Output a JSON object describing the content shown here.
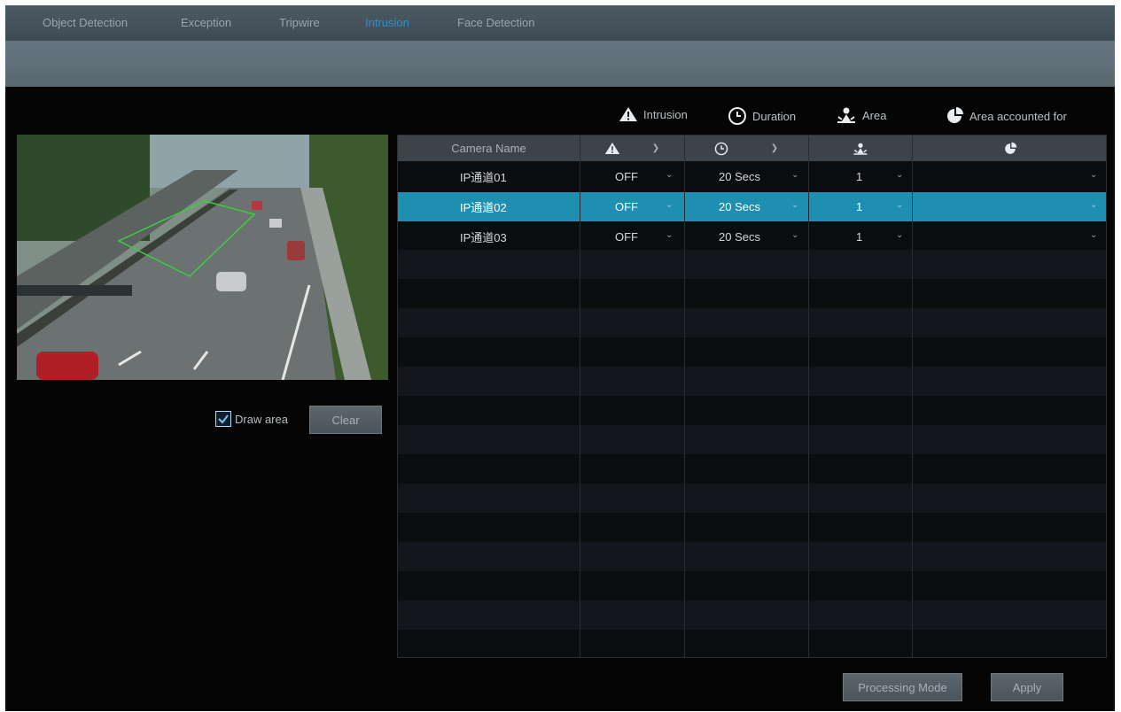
{
  "tabs": [
    "Object Detection",
    "Exception",
    "Tripwire",
    "Intrusion",
    "Face Detection"
  ],
  "active_tab": "Intrusion",
  "legend": {
    "intrusion": "Intrusion",
    "duration": "Duration",
    "area": "Area",
    "area_accounted": "Area accounted for"
  },
  "table": {
    "camera_header": "Camera Name",
    "rows": [
      {
        "camera": "IP通道01",
        "intrusion": "OFF",
        "duration": "20 Secs",
        "area": "1",
        "selected": false
      },
      {
        "camera": "IP通道02",
        "intrusion": "OFF",
        "duration": "20 Secs",
        "area": "1",
        "selected": true
      },
      {
        "camera": "IP通道03",
        "intrusion": "OFF",
        "duration": "20 Secs",
        "area": "1",
        "selected": false
      }
    ]
  },
  "draw_area": {
    "label": "Draw area",
    "checked": true
  },
  "buttons": {
    "clear": "Clear",
    "processing_mode": "Processing Mode",
    "apply": "Apply"
  },
  "colors": {
    "accent": "#2f8fd0",
    "selected_row": "#1d8fb0"
  }
}
